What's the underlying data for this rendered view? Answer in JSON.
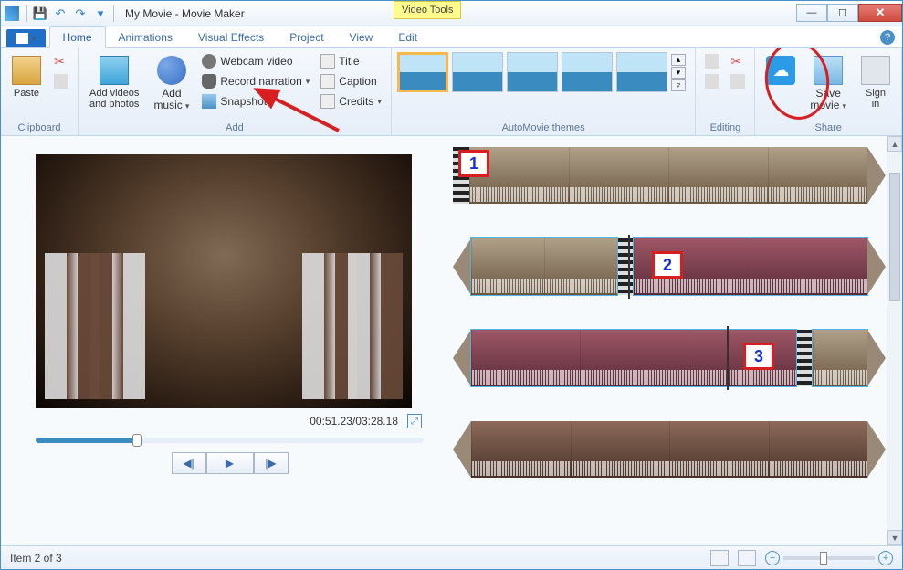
{
  "titlebar": {
    "title": "My Movie - Movie Maker",
    "contextual_tab": "Video Tools"
  },
  "tabs": {
    "file": "",
    "items": [
      "Home",
      "Animations",
      "Visual Effects",
      "Project",
      "View",
      "Edit"
    ],
    "active": "Home"
  },
  "ribbon": {
    "clipboard": {
      "label": "Clipboard",
      "paste": "Paste"
    },
    "add": {
      "label": "Add",
      "add_videos": "Add videos\nand photos",
      "add_music": "Add\nmusic",
      "webcam": "Webcam video",
      "record": "Record narration",
      "snapshot": "Snapshot",
      "caption_title": "Title",
      "caption_caption": "Caption",
      "caption_credits": "Credits"
    },
    "automovie": {
      "label": "AutoMovie themes"
    },
    "editing": {
      "label": "Editing"
    },
    "share": {
      "label": "Share",
      "save_movie": "Save\nmovie",
      "sign_in": "Sign\nin"
    }
  },
  "preview": {
    "time": "00:51.23/03:28.18"
  },
  "clips": {
    "labels": [
      "1",
      "2",
      "3"
    ]
  },
  "status": {
    "item_text": "Item 2 of 3"
  }
}
